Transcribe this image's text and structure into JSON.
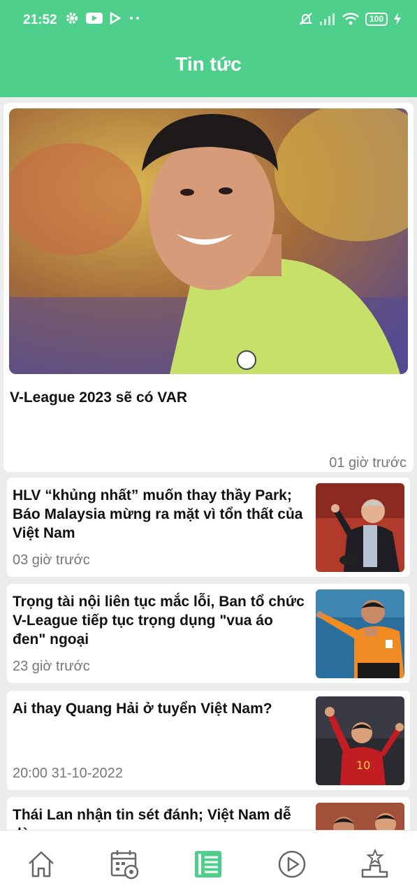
{
  "status_bar": {
    "time": "21:52",
    "battery": "100",
    "icons_left": [
      "gear-icon",
      "youtube-icon",
      "play-store-icon",
      "more-dots-icon"
    ],
    "icons_right": [
      "mute-icon",
      "signal-icon",
      "wifi-icon",
      "battery-icon",
      "charging-icon"
    ]
  },
  "header": {
    "title": "Tin tức"
  },
  "featured": {
    "title": "V-League 2023 sẽ có VAR",
    "time": "01 giờ trước"
  },
  "news": [
    {
      "title": "HLV “khủng nhất” muốn thay thầy Park; Báo Malaysia mừng ra mặt vì tổn thất của Việt Nam",
      "time": "03 giờ trước"
    },
    {
      "title": "Trọng tài nội liên tục mắc lỗi, Ban tổ chức V-League tiếp tục trọng dụng \"vua áo đen\" ngoại",
      "time": "23 giờ trước"
    },
    {
      "title": "Ai thay Quang Hải ở tuyển Việt Nam?",
      "time": "20:00 31-10-2022"
    },
    {
      "title": "Thái Lan nhận tin sét đánh; Việt Nam dễ dàng",
      "time": ""
    }
  ],
  "bottom_nav": {
    "items": [
      "home-icon",
      "schedule-icon",
      "news-icon",
      "video-icon",
      "ranking-icon"
    ],
    "active": "news-icon",
    "active_color": "#4fcf8c",
    "inactive_color": "#666666"
  },
  "colors": {
    "brand": "#4fcf8c",
    "muted_text": "#777777"
  }
}
